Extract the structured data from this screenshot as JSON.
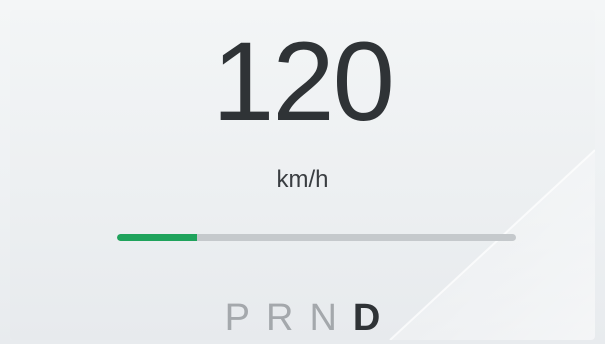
{
  "speed": {
    "value": "120",
    "unit": "km/h"
  },
  "progress": {
    "fraction": 0.2,
    "fill_color": "#1fa35c",
    "track_color": "#c5c9cc"
  },
  "gear_selector": {
    "gears": [
      "P",
      "R",
      "N",
      "D"
    ],
    "active": "D"
  }
}
